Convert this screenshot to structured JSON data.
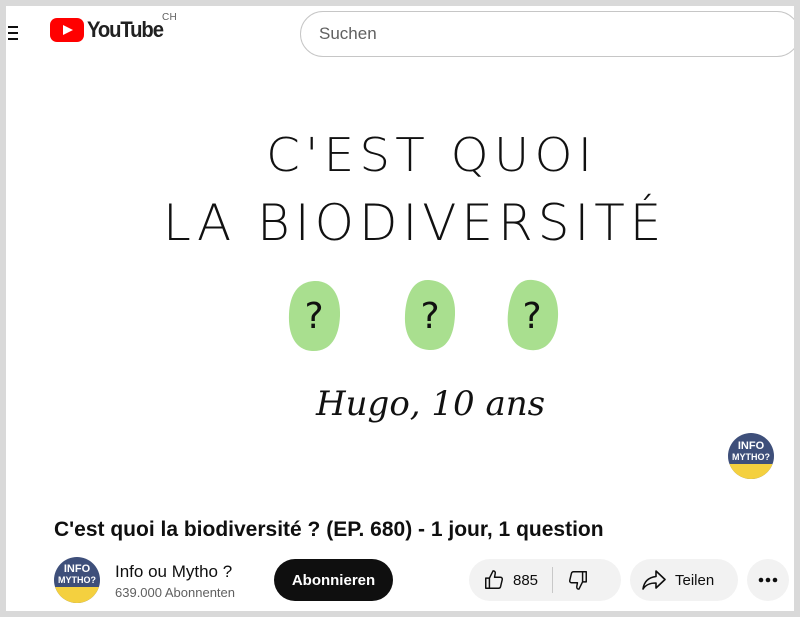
{
  "header": {
    "logo_text": "YouTube",
    "country_code": "CH",
    "search_placeholder": "Suchen"
  },
  "video": {
    "line1": "C'EST QUOI",
    "line2": "LA BIODIVERSITÉ",
    "question_mark": "?",
    "signature": "Hugo, 10 ans",
    "watermark_top": "INFO",
    "watermark_bottom": "MYTHO?"
  },
  "title": "C'est quoi la biodiversité ? (EP. 680) - 1 jour, 1 question",
  "channel": {
    "name": "Info ou Mytho ?",
    "subscribers": "639.000 Abonnenten",
    "avatar_top": "INFO",
    "avatar_bottom": "MYTHO?"
  },
  "actions": {
    "subscribe_label": "Abonnieren",
    "like_count": "885",
    "share_label": "Teilen"
  },
  "colors": {
    "brand_red": "#ff0000",
    "question_blob": "#a9df8f",
    "button_bg": "#f2f2f2",
    "subscribe_bg": "#0f0f0f"
  }
}
